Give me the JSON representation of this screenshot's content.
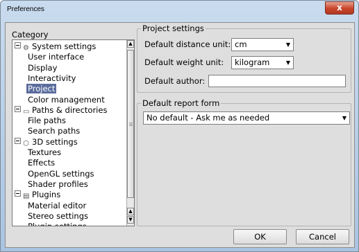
{
  "window": {
    "title": "Preferences",
    "close_glyph": "x"
  },
  "category": {
    "label": "Category",
    "items": [
      {
        "label": "System settings",
        "icon": "gear-icon",
        "level": 0
      },
      {
        "label": "User interface",
        "level": 1
      },
      {
        "label": "Display",
        "level": 1
      },
      {
        "label": "Interactivity",
        "level": 1
      },
      {
        "label": "Project",
        "level": 1,
        "selected": true
      },
      {
        "label": "Color management",
        "level": 1
      },
      {
        "label": "Paths & directories",
        "icon": "folder-icon",
        "level": 0
      },
      {
        "label": "File paths",
        "level": 1
      },
      {
        "label": "Search paths",
        "level": 1
      },
      {
        "label": "3D settings",
        "icon": "cube-icon",
        "level": 0
      },
      {
        "label": "Textures",
        "level": 1
      },
      {
        "label": "Effects",
        "level": 1
      },
      {
        "label": "OpenGL settings",
        "level": 1
      },
      {
        "label": "Shader profiles",
        "level": 1
      },
      {
        "label": "Plugins",
        "icon": "plugin-icon",
        "level": 0
      },
      {
        "label": "Material editor",
        "level": 1
      },
      {
        "label": "Stereo settings",
        "level": 1
      },
      {
        "label": "Plugin settings",
        "level": 1
      }
    ]
  },
  "project_settings": {
    "title": "Project settings",
    "distance_label": "Default distance unit:",
    "distance_value": "cm",
    "weight_label": "Default weight unit:",
    "weight_value": "kilogram",
    "author_label": "Default author:",
    "author_value": ""
  },
  "report_form": {
    "title": "Default report form",
    "value": "No default - Ask me as needed"
  },
  "buttons": {
    "ok": "OK",
    "cancel": "Cancel"
  }
}
